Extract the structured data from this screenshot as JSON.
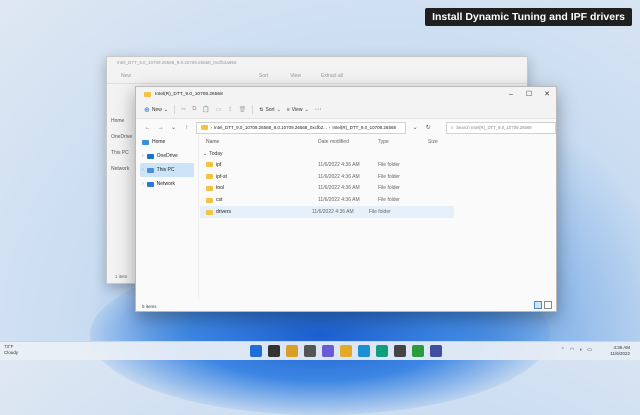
{
  "caption": "Install Dynamic Tuning and IPF drivers",
  "back_window": {
    "title": "Intel_DTT_9.0_10709.26568_9.0.10709.26568_0xcfb2a69d",
    "toolbar": [
      "New",
      "Sort",
      "View",
      "Extract all"
    ],
    "sidebar": [
      "Home",
      "OneDrive",
      "This PC",
      "Network"
    ],
    "status": "1 item"
  },
  "window": {
    "title": "Intel(R)_DTT_9.0_10709.26568",
    "toolbar": {
      "new_label": "New",
      "sort_label": "Sort",
      "view_label": "View"
    },
    "address": {
      "segments": [
        "Intel_DTT_9.0_10709.26568_9.0.10709.26568_0xcfb2...",
        "Intel(R)_DTT_9.0_10709.26568"
      ],
      "search_placeholder": "Search Intel(R)_DTT_9.0_10709.26568"
    },
    "nav": [
      {
        "label": "Home",
        "color": "#3c8fdf"
      },
      {
        "label": "OneDrive",
        "color": "#1a73c8"
      },
      {
        "label": "This PC",
        "color": "#4a90d9"
      },
      {
        "label": "Network",
        "color": "#2d7bd1"
      }
    ],
    "columns": {
      "name": "Name",
      "date": "Date modified",
      "type": "Type",
      "size": "Size"
    },
    "group_label": "Today",
    "files": [
      {
        "name": "ipf",
        "date": "11/6/2022 4:36 AM",
        "type": "File folder",
        "size": ""
      },
      {
        "name": "ipf-st",
        "date": "11/6/2022 4:36 AM",
        "type": "File folder",
        "size": ""
      },
      {
        "name": "tool",
        "date": "11/6/2022 4:36 AM",
        "type": "File folder",
        "size": ""
      },
      {
        "name": "cst",
        "date": "11/6/2022 4:36 AM",
        "type": "File folder",
        "size": ""
      },
      {
        "name": "drivers",
        "date": "11/6/2022 4:36 AM",
        "type": "File folder",
        "size": ""
      }
    ],
    "status": "5 items"
  },
  "taskbar": {
    "weather_temp": "73°F",
    "weather_desc": "Cloudy",
    "time": "4:36 AM",
    "date": "11/6/2022",
    "icons": [
      "windows-icon",
      "search-icon",
      "files-icon",
      "task-view-icon",
      "chat-icon",
      "explorer-icon",
      "edge-icon",
      "edge-dev-icon",
      "store-icon",
      "xbox-icon",
      "terminal-icon"
    ],
    "icon_colors": [
      "#1f6fd8",
      "#333333",
      "#d9a028",
      "#555555",
      "#6b5bd6",
      "#e3a92b",
      "#1b8fd8",
      "#129e7c",
      "#444444",
      "#2c9b3e",
      "#3e4fa0"
    ]
  }
}
